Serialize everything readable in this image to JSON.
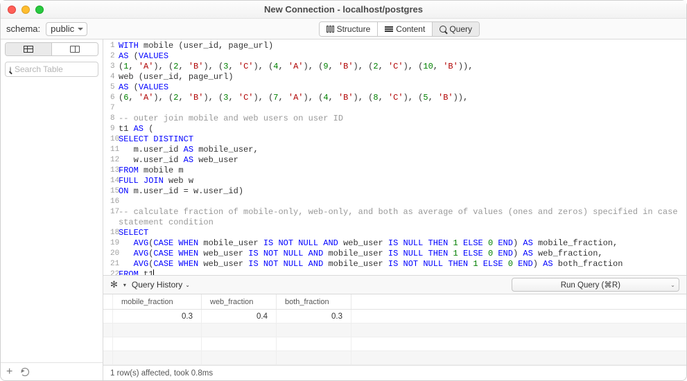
{
  "window": {
    "title": "New Connection - localhost/postgres"
  },
  "schema": {
    "label": "schema:",
    "value": "public"
  },
  "top_tabs": {
    "structure": "Structure",
    "content": "Content",
    "query": "Query"
  },
  "search": {
    "placeholder": "Search Table"
  },
  "query_bar": {
    "history": "Query History",
    "run": "Run Query (⌘R)"
  },
  "code": {
    "lines": [
      {
        "n": 1,
        "seg": [
          {
            "t": "WITH",
            "c": "kw"
          },
          {
            "t": " mobile (user_id, page_url)"
          }
        ]
      },
      {
        "n": 2,
        "seg": [
          {
            "t": "AS",
            "c": "kw"
          },
          {
            "t": " ("
          },
          {
            "t": "VALUES",
            "c": "kw"
          }
        ]
      },
      {
        "n": 3,
        "seg": [
          {
            "t": "("
          },
          {
            "t": "1",
            "c": "num"
          },
          {
            "t": ", "
          },
          {
            "t": "'A'",
            "c": "str"
          },
          {
            "t": "), ("
          },
          {
            "t": "2",
            "c": "num"
          },
          {
            "t": ", "
          },
          {
            "t": "'B'",
            "c": "str"
          },
          {
            "t": "), ("
          },
          {
            "t": "3",
            "c": "num"
          },
          {
            "t": ", "
          },
          {
            "t": "'C'",
            "c": "str"
          },
          {
            "t": "), ("
          },
          {
            "t": "4",
            "c": "num"
          },
          {
            "t": ", "
          },
          {
            "t": "'A'",
            "c": "str"
          },
          {
            "t": "), ("
          },
          {
            "t": "9",
            "c": "num"
          },
          {
            "t": ", "
          },
          {
            "t": "'B'",
            "c": "str"
          },
          {
            "t": "), ("
          },
          {
            "t": "2",
            "c": "num"
          },
          {
            "t": ", "
          },
          {
            "t": "'C'",
            "c": "str"
          },
          {
            "t": "), ("
          },
          {
            "t": "10",
            "c": "num"
          },
          {
            "t": ", "
          },
          {
            "t": "'B'",
            "c": "str"
          },
          {
            "t": ")),"
          }
        ]
      },
      {
        "n": 4,
        "seg": [
          {
            "t": "web (user_id, page_url)"
          }
        ]
      },
      {
        "n": 5,
        "seg": [
          {
            "t": "AS",
            "c": "kw"
          },
          {
            "t": " ("
          },
          {
            "t": "VALUES",
            "c": "kw"
          }
        ]
      },
      {
        "n": 6,
        "seg": [
          {
            "t": "("
          },
          {
            "t": "6",
            "c": "num"
          },
          {
            "t": ", "
          },
          {
            "t": "'A'",
            "c": "str"
          },
          {
            "t": "), ("
          },
          {
            "t": "2",
            "c": "num"
          },
          {
            "t": ", "
          },
          {
            "t": "'B'",
            "c": "str"
          },
          {
            "t": "), ("
          },
          {
            "t": "3",
            "c": "num"
          },
          {
            "t": ", "
          },
          {
            "t": "'C'",
            "c": "str"
          },
          {
            "t": "), ("
          },
          {
            "t": "7",
            "c": "num"
          },
          {
            "t": ", "
          },
          {
            "t": "'A'",
            "c": "str"
          },
          {
            "t": "), ("
          },
          {
            "t": "4",
            "c": "num"
          },
          {
            "t": ", "
          },
          {
            "t": "'B'",
            "c": "str"
          },
          {
            "t": "), ("
          },
          {
            "t": "8",
            "c": "num"
          },
          {
            "t": ", "
          },
          {
            "t": "'C'",
            "c": "str"
          },
          {
            "t": "), ("
          },
          {
            "t": "5",
            "c": "num"
          },
          {
            "t": ", "
          },
          {
            "t": "'B'",
            "c": "str"
          },
          {
            "t": ")),"
          }
        ]
      },
      {
        "n": 7,
        "seg": []
      },
      {
        "n": 8,
        "seg": [
          {
            "t": "-- outer join mobile and web users on user ID",
            "c": "com"
          }
        ]
      },
      {
        "n": 9,
        "seg": [
          {
            "t": "t1 "
          },
          {
            "t": "AS",
            "c": "kw"
          },
          {
            "t": " ("
          }
        ]
      },
      {
        "n": 10,
        "seg": [
          {
            "t": "SELECT DISTINCT",
            "c": "kw"
          }
        ]
      },
      {
        "n": 11,
        "seg": [
          {
            "t": "   m.user_id "
          },
          {
            "t": "AS",
            "c": "kw"
          },
          {
            "t": " mobile_user,"
          }
        ]
      },
      {
        "n": 12,
        "seg": [
          {
            "t": "   w.user_id "
          },
          {
            "t": "AS",
            "c": "kw"
          },
          {
            "t": " web_user"
          }
        ]
      },
      {
        "n": 13,
        "seg": [
          {
            "t": "FROM",
            "c": "kw"
          },
          {
            "t": " mobile m"
          }
        ]
      },
      {
        "n": 14,
        "seg": [
          {
            "t": "FULL JOIN",
            "c": "kw"
          },
          {
            "t": " web w"
          }
        ]
      },
      {
        "n": 15,
        "seg": [
          {
            "t": "ON",
            "c": "kw"
          },
          {
            "t": " m.user_id = w.user_id)"
          }
        ]
      },
      {
        "n": 16,
        "seg": []
      },
      {
        "n": 17,
        "seg": [
          {
            "t": "-- calculate fraction of mobile-only, web-only, and both as average of values (ones and zeros) specified in case statement condition",
            "c": "com"
          }
        ],
        "wrap": true
      },
      {
        "n": 18,
        "seg": [
          {
            "t": "SELECT",
            "c": "kw"
          }
        ]
      },
      {
        "n": 19,
        "seg": [
          {
            "t": "   "
          },
          {
            "t": "AVG",
            "c": "kw"
          },
          {
            "t": "("
          },
          {
            "t": "CASE WHEN",
            "c": "kw"
          },
          {
            "t": " mobile_user "
          },
          {
            "t": "IS NOT NULL AND",
            "c": "kw"
          },
          {
            "t": " web_user "
          },
          {
            "t": "IS NULL THEN",
            "c": "kw"
          },
          {
            "t": " "
          },
          {
            "t": "1",
            "c": "num"
          },
          {
            "t": " "
          },
          {
            "t": "ELSE",
            "c": "kw"
          },
          {
            "t": " "
          },
          {
            "t": "0",
            "c": "num"
          },
          {
            "t": " "
          },
          {
            "t": "END",
            "c": "kw"
          },
          {
            "t": ") "
          },
          {
            "t": "AS",
            "c": "kw"
          },
          {
            "t": " mobile_fraction,"
          }
        ]
      },
      {
        "n": 20,
        "seg": [
          {
            "t": "   "
          },
          {
            "t": "AVG",
            "c": "kw"
          },
          {
            "t": "("
          },
          {
            "t": "CASE WHEN",
            "c": "kw"
          },
          {
            "t": " web_user "
          },
          {
            "t": "IS NOT NULL AND",
            "c": "kw"
          },
          {
            "t": " mobile_user "
          },
          {
            "t": "IS NULL THEN",
            "c": "kw"
          },
          {
            "t": " "
          },
          {
            "t": "1",
            "c": "num"
          },
          {
            "t": " "
          },
          {
            "t": "ELSE",
            "c": "kw"
          },
          {
            "t": " "
          },
          {
            "t": "0",
            "c": "num"
          },
          {
            "t": " "
          },
          {
            "t": "END",
            "c": "kw"
          },
          {
            "t": ") "
          },
          {
            "t": "AS",
            "c": "kw"
          },
          {
            "t": " web_fraction,"
          }
        ]
      },
      {
        "n": 21,
        "seg": [
          {
            "t": "   "
          },
          {
            "t": "AVG",
            "c": "kw"
          },
          {
            "t": "("
          },
          {
            "t": "CASE WHEN",
            "c": "kw"
          },
          {
            "t": " web_user "
          },
          {
            "t": "IS NOT NULL AND",
            "c": "kw"
          },
          {
            "t": " mobile_user "
          },
          {
            "t": "IS NOT NULL THEN",
            "c": "kw"
          },
          {
            "t": " "
          },
          {
            "t": "1",
            "c": "num"
          },
          {
            "t": " "
          },
          {
            "t": "ELSE",
            "c": "kw"
          },
          {
            "t": " "
          },
          {
            "t": "0",
            "c": "num"
          },
          {
            "t": " "
          },
          {
            "t": "END",
            "c": "kw"
          },
          {
            "t": ") "
          },
          {
            "t": "AS",
            "c": "kw"
          },
          {
            "t": " both_fraction"
          }
        ]
      },
      {
        "n": 22,
        "seg": [
          {
            "t": "FROM",
            "c": "kw"
          },
          {
            "t": " t1"
          }
        ],
        "cursor": true
      }
    ]
  },
  "results": {
    "columns": [
      "mobile_fraction",
      "web_fraction",
      "both_fraction"
    ],
    "rows": [
      [
        "0.3",
        "0.4",
        "0.3"
      ]
    ]
  },
  "status": {
    "text": "1 row(s) affected, took 0.8ms"
  }
}
